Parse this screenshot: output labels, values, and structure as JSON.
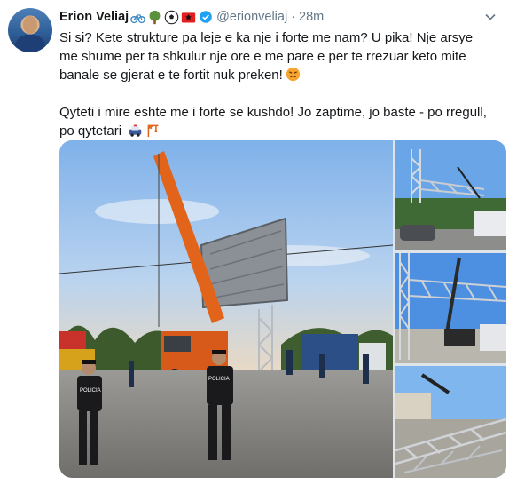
{
  "tweet": {
    "author_name": "Erion Veliaj",
    "author_emojis": [
      "bicycle-icon",
      "tree-icon",
      "soccer-ball-icon",
      "albania-flag-icon"
    ],
    "handle": "@erionveliaj",
    "separator": "·",
    "time": "28m",
    "paragraph1": "Si si? Kete strukture pa leje e ka nje i forte me nam? U pika! Nje arsye me shume per ta shkulur nje ore e me pare e per te rrezuar keto mite banale se gjerat e te fortit nuk preken!",
    "paragraph2": "Qyteti i mire eshte me i forte se kushdo! Jo zaptime, jo baste - po rregull, po qytetari",
    "photo1_police_label_left": "POLICIA",
    "photo1_police_label_right": "POLICIA"
  },
  "colors": {
    "link_blue": "#1da1f2",
    "muted": "#657786",
    "crane_orange": "#e2641b",
    "sky": "#9ec5ef"
  }
}
